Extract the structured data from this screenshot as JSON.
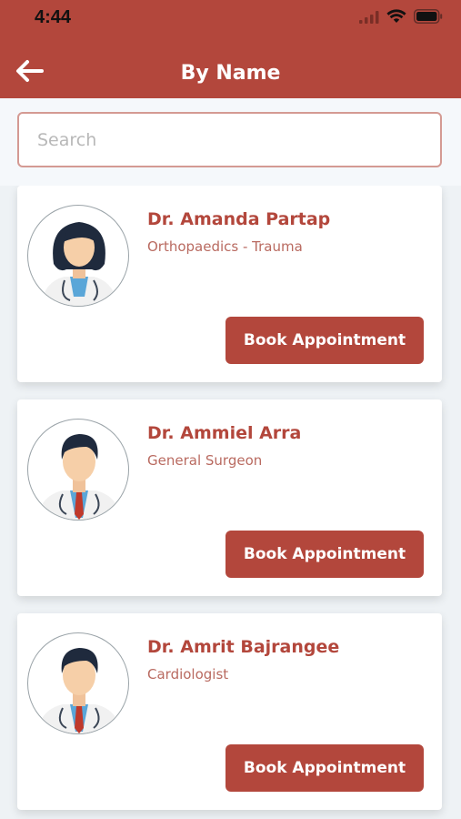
{
  "status_bar": {
    "time": "4:44",
    "icons": [
      "signal-icon",
      "wifi-icon",
      "battery-icon"
    ]
  },
  "header": {
    "title": "By Name",
    "back_icon": "back-arrow-icon",
    "color": "#b3473c"
  },
  "search": {
    "placeholder": "Search",
    "value": ""
  },
  "doctors": [
    {
      "name": "Dr. Amanda Partap",
      "specialty": "Orthopaedics - Trauma",
      "avatar": "female-doctor-avatar",
      "button_label": "Book Appointment"
    },
    {
      "name": "Dr. Ammiel Arra",
      "specialty": "General Surgeon",
      "avatar": "male-doctor-avatar",
      "button_label": "Book Appointment"
    },
    {
      "name": "Dr. Amrit Bajrangee",
      "specialty": "Cardiologist",
      "avatar": "male-doctor-avatar",
      "button_label": "Book Appointment"
    }
  ]
}
